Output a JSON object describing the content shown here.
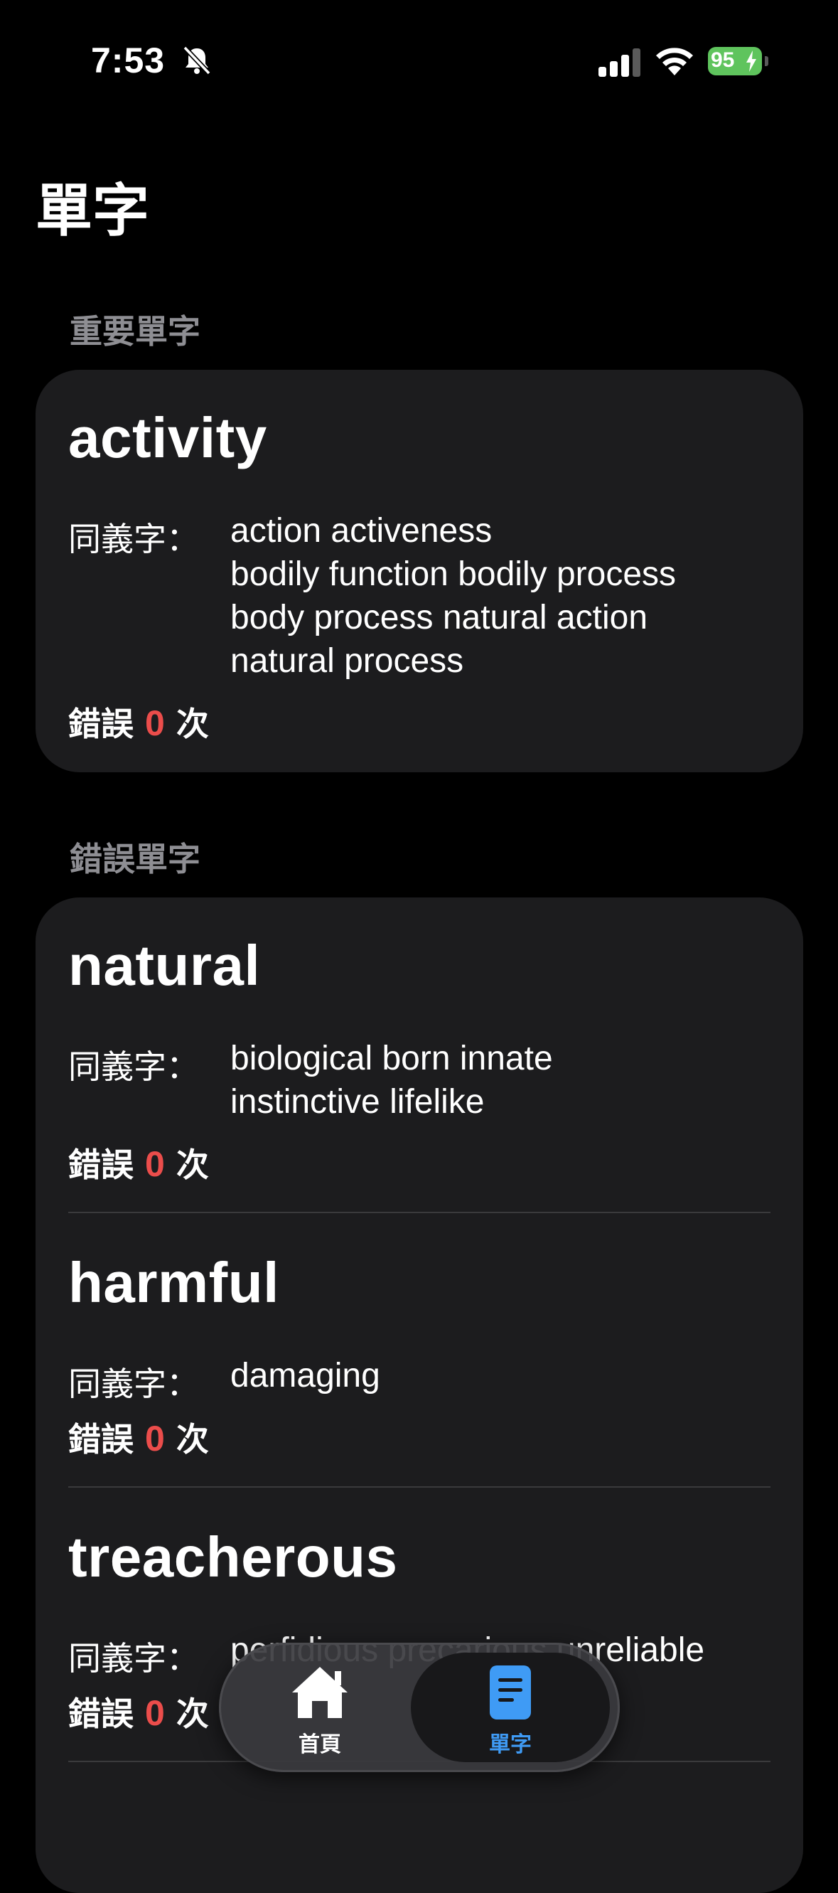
{
  "status_bar": {
    "time": "7:53",
    "battery_level": "95"
  },
  "page": {
    "title": "單字"
  },
  "colors": {
    "background": "#000000",
    "card": "#1c1c1e",
    "section_header": "#8e8e93",
    "error_count": "#eb4d4b",
    "accent": "#3f9bf5",
    "battery": "#5fc45d"
  },
  "sections": {
    "important": {
      "header": "重要單字",
      "entries": [
        {
          "word": "activity",
          "synonym_label": "同義字：",
          "synonym_lines": [
            "action  activeness",
            "bodily function  bodily process",
            "body process  natural action",
            "natural process"
          ],
          "error_prefix": "錯誤",
          "error_count": "0",
          "error_suffix": "次"
        }
      ]
    },
    "wrong": {
      "header": "錯誤單字",
      "entries": [
        {
          "word": "natural",
          "synonym_label": "同義字：",
          "synonym_lines": [
            "biological  born  innate",
            "instinctive  lifelike"
          ],
          "error_prefix": "錯誤",
          "error_count": "0",
          "error_suffix": "次"
        },
        {
          "word": "harmful",
          "synonym_label": "同義字：",
          "synonym_lines": [
            "damaging"
          ],
          "error_prefix": "錯誤",
          "error_count": "0",
          "error_suffix": "次"
        },
        {
          "word": "treacherous",
          "synonym_label": "同義字：",
          "synonym_lines": [
            "perfidious  precarious  unreliable"
          ],
          "error_prefix": "錯誤",
          "error_count": "0",
          "error_suffix": "次"
        }
      ]
    }
  },
  "tab_bar": {
    "tabs": [
      {
        "label": "首頁",
        "icon": "house-icon",
        "selected": false
      },
      {
        "label": "單字",
        "icon": "document-icon",
        "selected": true
      }
    ]
  }
}
